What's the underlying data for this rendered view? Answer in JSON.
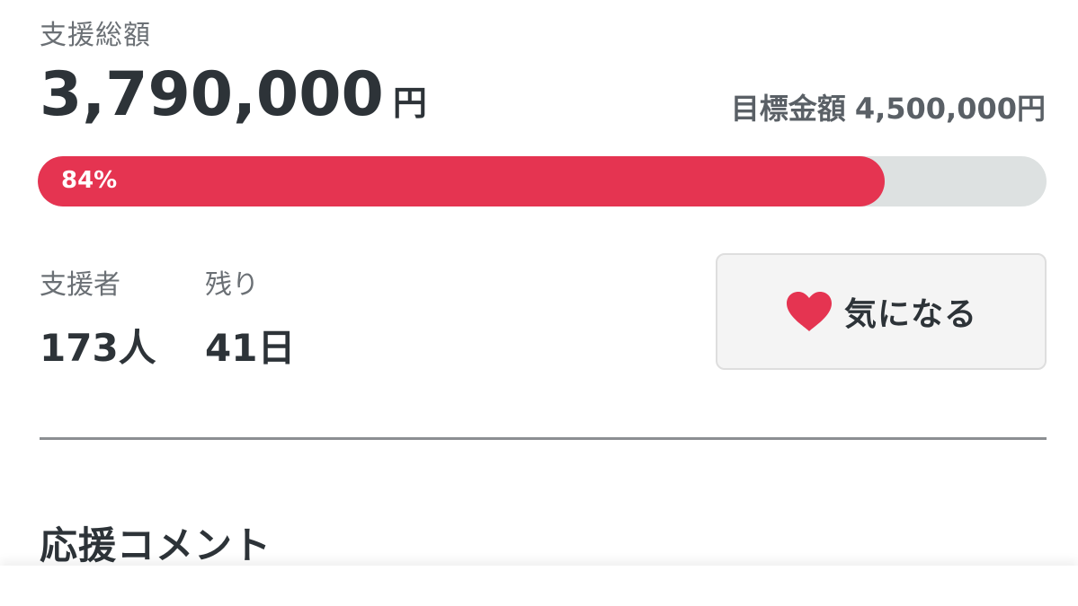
{
  "funding": {
    "total_label": "支援総額",
    "total_value": "3,790,000",
    "total_unit": "円",
    "goal_label": "目標金額",
    "goal_value": "4,500,000円",
    "progress_percent": 84,
    "progress_text": "84%"
  },
  "stats": {
    "backers_label": "支援者",
    "backers_value": "173人",
    "remaining_label": "残り",
    "remaining_value": "41日"
  },
  "favorite_button": {
    "icon": "heart-icon",
    "label": "気になる"
  },
  "comments": {
    "section_title": "応援コメント"
  },
  "colors": {
    "accent": "#e53451",
    "track": "#dde1e1",
    "text": "#2d3338",
    "muted": "#6b7075"
  }
}
